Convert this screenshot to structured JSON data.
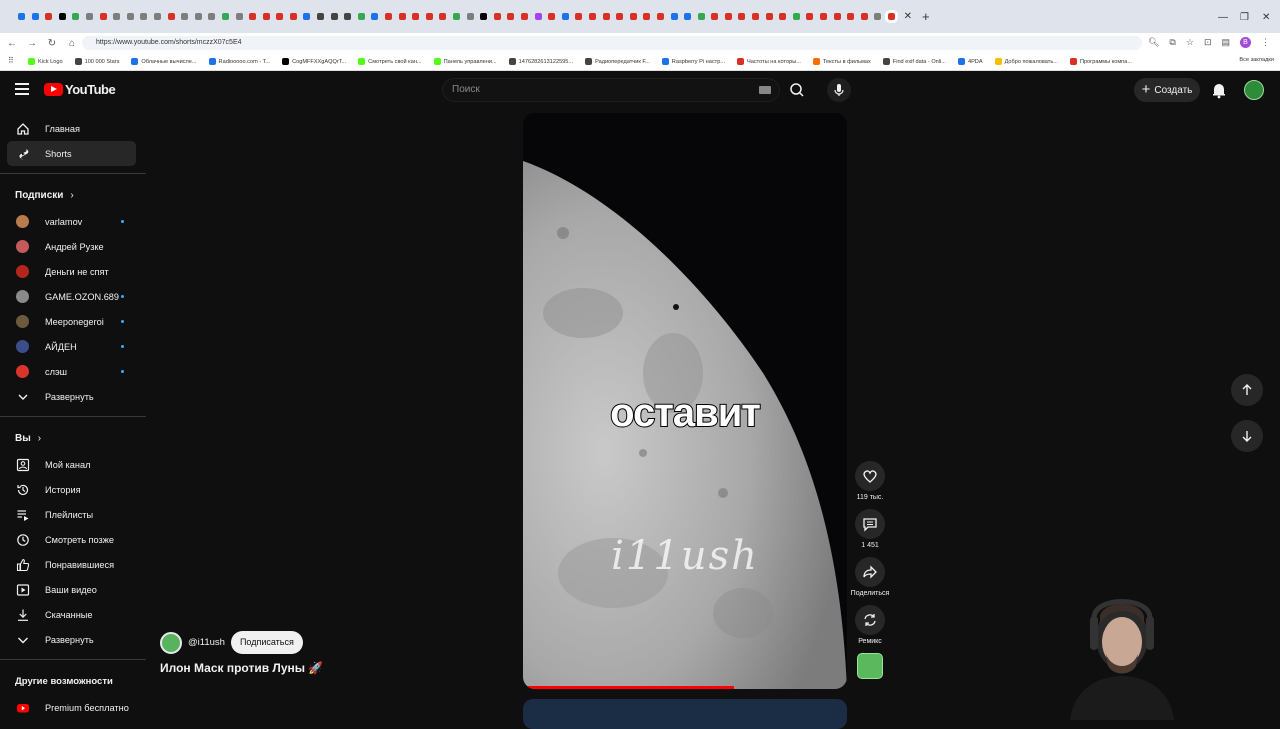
{
  "browser": {
    "tab_icon_colors": [
      "#1a73e8",
      "#1a73e8",
      "#d93025",
      "#000000",
      "#34a853",
      "#7e7e7e",
      "#d93025",
      "#7e7e7e",
      "#7e7e7e",
      "#7e7e7e",
      "#7e7e7e",
      "#d93025",
      "#7e7e7e",
      "#7e7e7e",
      "#7e7e7e",
      "#34a853",
      "#7e7e7e",
      "#d93025",
      "#d93025",
      "#d93025",
      "#d93025",
      "#1a73e8",
      "#444444",
      "#444444",
      "#444444",
      "#34a853",
      "#1a73e8",
      "#d93025",
      "#d93025",
      "#d93025",
      "#d93025",
      "#d93025",
      "#34a853",
      "#7e7e7e",
      "#000000",
      "#d93025",
      "#d93025",
      "#d93025",
      "#a142f4",
      "#d93025",
      "#1a73e8",
      "#d93025",
      "#d93025",
      "#d93025",
      "#d93025",
      "#d93025",
      "#d93025",
      "#d93025",
      "#1a73e8",
      "#1a73e8",
      "#34a853",
      "#d93025",
      "#d93025",
      "#d93025",
      "#d93025",
      "#d93025",
      "#d93025",
      "#34a853",
      "#d93025",
      "#d93025",
      "#d93025",
      "#d93025",
      "#d93025",
      "#7e7e7e",
      "#d93025"
    ],
    "url": "https://www.youtube.com/shorts/mczzX07c5E4",
    "bookmarks": [
      {
        "label": "Kick Logo",
        "color": "#53fc18"
      },
      {
        "label": "100 000 Stars",
        "color": "#444444"
      },
      {
        "label": "Облачные вычисле...",
        "color": "#1a73e8"
      },
      {
        "label": "Radiooooo.com - T...",
        "color": "#1a73e8"
      },
      {
        "label": "CogMFFXXgAQQrT...",
        "color": "#000000"
      },
      {
        "label": "Смотреть свой кан...",
        "color": "#53fc18"
      },
      {
        "label": "Панель управлени...",
        "color": "#53fc18"
      },
      {
        "label": "1476282613122595...",
        "color": "#444444"
      },
      {
        "label": "Радиопередатчик F...",
        "color": "#444444"
      },
      {
        "label": "Raspberry Pi настр...",
        "color": "#1a73e8"
      },
      {
        "label": "Частоты на которы...",
        "color": "#d93025"
      },
      {
        "label": "Тексты в фильмах",
        "color": "#ff6d00"
      },
      {
        "label": "Find exif data - Onli...",
        "color": "#444444"
      },
      {
        "label": "4PDA",
        "color": "#1a73e8"
      },
      {
        "label": "Добро пожаловать...",
        "color": "#fbbc04"
      },
      {
        "label": "Программы компа...",
        "color": "#d93025"
      }
    ],
    "bookmarks_all": "Все закладки",
    "profile_letter": "В"
  },
  "header": {
    "logo_text": "YouTube",
    "search_placeholder": "Поиск",
    "create_label": "Создать"
  },
  "sidebar": {
    "main": [
      {
        "label": "Главная",
        "icon": "home-icon"
      },
      {
        "label": "Shorts",
        "icon": "shorts-icon",
        "active": true
      }
    ],
    "subscriptions_title": "Подписки",
    "subscriptions": [
      {
        "label": "varlamov",
        "color": "#b87c4c",
        "live": true
      },
      {
        "label": "Андрей Рузке",
        "color": "#c45a5a",
        "live": false
      },
      {
        "label": "Деньги не спят",
        "color": "#b3261e",
        "live": false
      },
      {
        "label": "GAME.OZON.689",
        "color": "#8a8a8a",
        "live": true
      },
      {
        "label": "Meeponegeroi",
        "color": "#6c5b3b",
        "live": true
      },
      {
        "label": "АЙДЕН",
        "color": "#3b4e8c",
        "live": true
      },
      {
        "label": "слэш",
        "color": "#d9352a",
        "live": true
      }
    ],
    "subscriptions_expand": "Развернуть",
    "you_title": "Вы",
    "you": [
      {
        "label": "Мой канал",
        "icon": "channel-icon"
      },
      {
        "label": "История",
        "icon": "history-icon"
      },
      {
        "label": "Плейлисты",
        "icon": "playlists-icon"
      },
      {
        "label": "Смотреть позже",
        "icon": "watch-later-icon"
      },
      {
        "label": "Понравившиеся",
        "icon": "like-icon"
      },
      {
        "label": "Ваши видео",
        "icon": "your-videos-icon"
      },
      {
        "label": "Скачанные",
        "icon": "download-icon"
      },
      {
        "label": "Развернуть",
        "icon": "chevron-down-icon"
      }
    ],
    "more_title": "Другие возможности",
    "more": [
      {
        "label": "Premium бесплатно",
        "icon": "premium-icon"
      }
    ]
  },
  "short": {
    "caption": "оставит",
    "watermark": "i11ush",
    "progress_fraction": 0.65,
    "author": "@i11ush",
    "subscribe_label": "Подписаться",
    "title": "Илон Маск против Луны 🚀",
    "likes": "119 тыс.",
    "comments": "1 451",
    "share_label": "Поделиться",
    "remix_label": "Ремикс"
  }
}
